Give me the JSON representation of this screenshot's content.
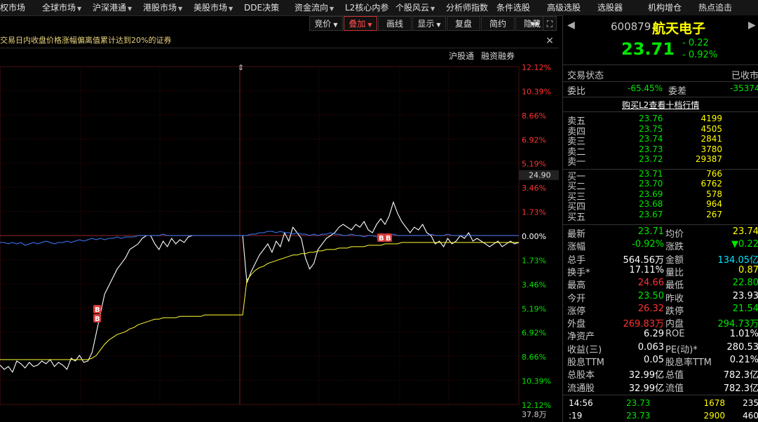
{
  "menu": [
    {
      "label": "权市场",
      "caret": false
    },
    {
      "label": "全球市场",
      "caret": true
    },
    {
      "label": "沪深港通",
      "caret": true
    },
    {
      "label": "港股市场",
      "caret": true
    },
    {
      "label": "美股市场",
      "caret": true
    },
    {
      "label": "DDE决策",
      "caret": false
    },
    {
      "label": "资金流向",
      "caret": true
    },
    {
      "label": "L2核心内参",
      "caret": false
    },
    {
      "label": "个股风云",
      "caret": true
    },
    {
      "label": "分析师指数",
      "caret": false
    },
    {
      "label": "条件选股",
      "caret": false
    },
    {
      "label": "高级选股",
      "caret": false
    },
    {
      "label": "选股器",
      "caret": false
    },
    {
      "label": "机构增仓",
      "caret": false
    },
    {
      "label": "热点追击",
      "caret": false
    }
  ],
  "toolbar": {
    "items": [
      {
        "label": "竞价",
        "caret": true,
        "active": false
      },
      {
        "label": "叠加",
        "caret": true,
        "active": true
      },
      {
        "label": "画线",
        "caret": false,
        "active": false
      },
      {
        "label": "显示",
        "caret": true,
        "active": false
      },
      {
        "label": "复盘",
        "caret": false,
        "active": false
      },
      {
        "label": "简约",
        "caret": false,
        "active": false
      },
      {
        "label": "隐藏",
        "caret": false,
        "active": false
      }
    ],
    "more_icon": "▸▸",
    "fullscreen_icon": "⛶"
  },
  "chart_header": {
    "title": "交易日内收盘价格涨幅偏离值累计达到20%的证券",
    "close": "×",
    "links": [
      "沪股通",
      "融资融券"
    ]
  },
  "chart_data": {
    "type": "line",
    "y_labels_right": [
      "12.12%",
      "10.39%",
      "8.66%",
      "6.92%",
      "5.19%",
      "3.46%",
      "1.73%",
      "0.00%",
      "1.73%",
      "3.46%",
      "5.19%",
      "6.92%",
      "8.66%",
      "10.39%",
      "12.12%"
    ],
    "y_label_colors": [
      "red",
      "red",
      "red",
      "red",
      "red",
      "red",
      "red",
      "white",
      "green",
      "green",
      "green",
      "green",
      "green",
      "green",
      "green"
    ],
    "crosshair_value": "24.90",
    "volume_label": "37.8万",
    "markers": [
      {
        "text": "B"
      },
      {
        "text": "B"
      },
      {
        "text": "B"
      },
      {
        "text": "B"
      }
    ],
    "series": [
      {
        "color": "#ffffff",
        "values": [
          -9.3,
          -9.6,
          -9.4,
          -9.8,
          -9.0,
          -9.2,
          -9.5,
          -9.1,
          -9.4,
          -9.3,
          -9.0,
          -9.2,
          -8.9,
          -9.4,
          -9.1,
          -9.3,
          -9.6,
          -8.8,
          -9.0,
          -8.6,
          -9.1,
          -9.0,
          -8.4,
          -7.0,
          -5.6,
          -4.2,
          -3.6,
          -3.0,
          -2.4,
          -2.0,
          -1.6,
          -1.0,
          -0.8,
          -0.6,
          -0.2,
          0.0,
          0.0,
          -0.6,
          -1.0,
          -0.4,
          -0.8,
          -0.2,
          -0.6,
          -0.3,
          -0.5,
          -0.1,
          0.0,
          0.0,
          0.0,
          0.0,
          0.0,
          0.0,
          0.0,
          0.0,
          0.0,
          0.0,
          0.0,
          0.0,
          0.0,
          -3.4,
          -2.6,
          -2.0,
          -1.4,
          -1.0,
          -0.6,
          -1.2,
          -0.4,
          -0.8,
          0.2,
          -0.4,
          0.6,
          0.2,
          -0.2,
          -1.6,
          -2.4,
          -2.0,
          -1.0,
          -0.6,
          -0.2,
          0.0,
          0.2,
          0.6,
          0.8,
          0.6,
          0.4,
          0.8,
          0.6,
          1.0,
          0.4,
          0.2,
          0.8,
          1.2,
          0.8,
          1.4,
          2.4,
          1.6,
          1.0,
          0.6,
          0.2,
          0.6,
          0.4,
          0.8,
          0.2,
          0.0,
          -0.6,
          -0.4,
          -0.8,
          -0.2,
          -0.6,
          -0.4,
          0.0,
          -0.2,
          0.2,
          -0.4,
          -0.2,
          -0.4,
          -0.6,
          -0.8,
          -0.6,
          -0.4,
          -0.8,
          -0.6,
          -0.4,
          -0.6,
          -0.5
        ]
      },
      {
        "color": "#ffff33",
        "values": [
          -8.9,
          -8.9,
          -8.9,
          -8.9,
          -8.9,
          -8.9,
          -8.9,
          -8.9,
          -8.9,
          -8.9,
          -8.9,
          -8.9,
          -8.9,
          -8.9,
          -8.9,
          -8.9,
          -8.9,
          -8.9,
          -8.9,
          -8.9,
          -8.9,
          -8.9,
          -8.8,
          -8.6,
          -8.2,
          -7.8,
          -7.5,
          -7.3,
          -7.1,
          -7.0,
          -6.9,
          -6.7,
          -6.6,
          -6.4,
          -6.3,
          -6.2,
          -6.1,
          -6.0,
          -6.0,
          -5.9,
          -5.9,
          -5.9,
          -5.9,
          -5.8,
          -5.8,
          -5.8,
          -5.8,
          -5.8,
          -5.8,
          -5.7,
          -5.7,
          -5.7,
          -5.7,
          -5.7,
          -5.7,
          -5.7,
          -5.7,
          -5.7,
          -5.7,
          -3.2,
          -2.8,
          -2.5,
          -2.3,
          -2.2,
          -2.0,
          -1.9,
          -1.8,
          -1.7,
          -1.6,
          -1.5,
          -1.4,
          -1.4,
          -1.3,
          -1.3,
          -1.2,
          -1.2,
          -1.1,
          -1.1,
          -1.0,
          -1.0,
          -1.0,
          -0.9,
          -0.9,
          -0.9,
          -0.8,
          -0.8,
          -0.8,
          -0.8,
          -0.7,
          -0.7,
          -0.7,
          -0.7,
          -0.6,
          -0.6,
          -0.6,
          -0.6,
          -0.5,
          -0.5,
          -0.5,
          -0.5,
          -0.5,
          -0.5,
          -0.5,
          -0.5,
          -0.5,
          -0.5,
          -0.5,
          -0.5,
          -0.5,
          -0.5,
          -0.5,
          -0.5,
          -0.5,
          -0.5,
          -0.5,
          -0.5,
          -0.5,
          -0.5,
          -0.5,
          -0.5,
          -0.5,
          -0.5,
          -0.5,
          -0.5,
          -0.5
        ]
      },
      {
        "color": "#3a7bff",
        "values": [
          -0.5,
          -0.5,
          -0.6,
          -0.5,
          -0.6,
          -0.5,
          -0.7,
          -0.6,
          -0.5,
          -0.6,
          -0.5,
          -0.4,
          -0.5,
          -0.6,
          -0.5,
          -0.5,
          -0.4,
          -0.5,
          -0.4,
          -0.3,
          -0.4,
          -0.3,
          -0.2,
          -0.3,
          -0.2,
          -0.3,
          -0.2,
          -0.2,
          -0.1,
          -0.2,
          -0.1,
          -0.1,
          -0.1,
          0.0,
          0.0,
          0.0,
          0.0,
          0.0,
          0.0,
          0.1,
          0.0,
          0.0,
          0.0,
          0.0,
          0.0,
          0.0,
          0.0,
          0.0,
          0.0,
          0.0,
          0.0,
          0.0,
          0.0,
          0.0,
          0.0,
          0.0,
          0.0,
          0.0,
          0.0,
          0.0,
          0.1,
          0.1,
          0.2,
          0.2,
          0.3,
          0.3,
          0.2,
          0.3,
          0.2,
          0.2,
          0.1,
          0.2,
          0.1,
          0.1,
          0.0,
          0.1,
          0.0,
          0.1,
          0.1,
          0.2,
          0.1,
          0.1,
          0.0,
          0.0,
          0.1,
          0.0,
          0.0,
          -0.1,
          0.0,
          0.0,
          -0.1,
          0.0,
          0.0,
          0.0,
          0.1,
          0.0,
          0.0,
          0.0,
          0.0,
          0.0,
          0.0,
          0.0,
          0.0,
          0.1,
          0.0,
          0.0,
          0.0,
          0.1,
          0.0,
          0.0,
          0.0,
          0.0,
          0.0,
          0.0,
          0.0,
          0.0,
          0.0,
          0.0,
          0.0,
          0.0,
          0.0,
          0.0,
          0.0,
          0.0,
          0.0
        ]
      }
    ]
  },
  "quote": {
    "code": "600879",
    "name": "航天电子",
    "price": "23.71",
    "change": "- 0.22",
    "change_pct": "- 0.92%",
    "status_label": "交易状态",
    "status_value": "已收市",
    "weibi_label": "委比",
    "weibi_value": "-65.45%",
    "weicha_label": "委差",
    "weicha_value": "-35374",
    "l2_link": "购买L2查看十档行情",
    "asks": [
      {
        "label": "卖五",
        "price": "23.76",
        "vol": "4199"
      },
      {
        "label": "卖四",
        "price": "23.75",
        "vol": "4505"
      },
      {
        "label": "卖三",
        "price": "23.74",
        "vol": "2841"
      },
      {
        "label": "卖二",
        "price": "23.73",
        "vol": "3780"
      },
      {
        "label": "卖一",
        "price": "23.72",
        "vol": "29387"
      }
    ],
    "bids": [
      {
        "label": "买一",
        "price": "23.71",
        "vol": "766"
      },
      {
        "label": "买二",
        "price": "23.70",
        "vol": "6762"
      },
      {
        "label": "买三",
        "price": "23.69",
        "vol": "578"
      },
      {
        "label": "买四",
        "price": "23.68",
        "vol": "964"
      },
      {
        "label": "买五",
        "price": "23.67",
        "vol": "267"
      }
    ],
    "stats": [
      {
        "l1": "最新",
        "v1": "23.71",
        "c1": "green",
        "l2": "均价",
        "v2": "23.74",
        "c2": "yellow"
      },
      {
        "l1": "涨幅",
        "v1": "-0.92%",
        "c1": "green",
        "l2": "涨跌",
        "v2": "▼0.22",
        "c2": "green"
      },
      {
        "l1": "总手",
        "v1": "564.56万",
        "c1": "white",
        "l2": "金额",
        "v2": "134.05亿",
        "c2": "cyan"
      },
      {
        "l1": "换手*",
        "v1": "17.11%",
        "c1": "white",
        "l2": "量比",
        "v2": "0.87",
        "c2": "yellow"
      },
      {
        "l1": "最高",
        "v1": "24.66",
        "c1": "red",
        "l2": "最低",
        "v2": "22.80",
        "c2": "green"
      },
      {
        "l1": "今开",
        "v1": "23.50",
        "c1": "green",
        "l2": "昨收",
        "v2": "23.93",
        "c2": "white"
      },
      {
        "l1": "涨停",
        "v1": "26.32",
        "c1": "red",
        "l2": "跌停",
        "v2": "21.54",
        "c2": "green"
      },
      {
        "l1": "外盘",
        "v1": "269.83万",
        "c1": "red",
        "l2": "内盘",
        "v2": "294.73万",
        "c2": "green"
      },
      {
        "l1": "净资产",
        "v1": "6.29",
        "c1": "white",
        "l2": "ROE",
        "v2": "1.01%",
        "c2": "white"
      },
      {
        "l1": "收益(三)",
        "v1": "0.063",
        "c1": "white",
        "l2": "PE(动)*",
        "v2": "280.53",
        "c2": "white"
      },
      {
        "l1": "股息TTM",
        "v1": "0.05",
        "c1": "white",
        "l2": "股息率TTM",
        "v2": "0.21%",
        "c2": "white"
      },
      {
        "l1": "总股本",
        "v1": "32.99亿",
        "c1": "white",
        "l2": "总值",
        "v2": "782.3亿",
        "c2": "white"
      },
      {
        "l1": "流通股",
        "v1": "32.99亿",
        "c1": "white",
        "l2": "流值",
        "v2": "782.3亿",
        "c2": "white"
      }
    ],
    "ticks": [
      {
        "time": "14:56",
        "price": "23.73",
        "vol": "1678",
        "extra": "235"
      },
      {
        "time": ":19",
        "price": "23.73",
        "vol": "2900",
        "extra": "460"
      }
    ]
  }
}
